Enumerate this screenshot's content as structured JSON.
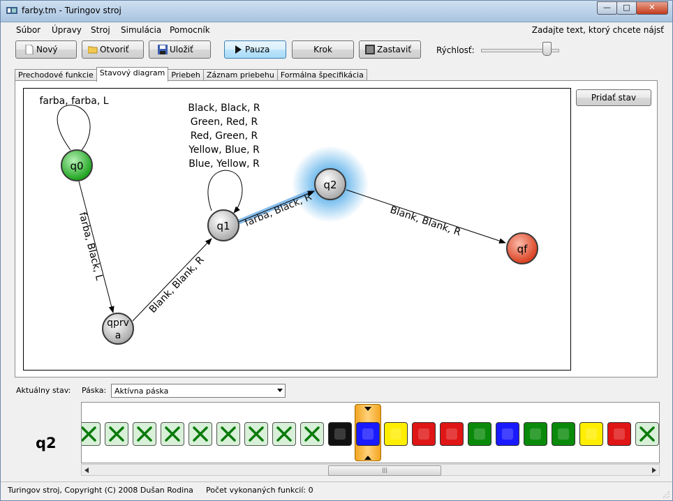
{
  "window": {
    "title": "farby.tm - Turingov stroj",
    "btn_min": "—",
    "btn_max": "□",
    "btn_close": "✕"
  },
  "menu": {
    "file": "Súbor",
    "edit": "Úpravy",
    "machine": "Stroj",
    "simulation": "Simulácia",
    "help": "Pomocník",
    "find_hint": "Zadajte text, ktorý chcete nájsť"
  },
  "toolbar": {
    "new": "Nový",
    "open": "Otvoriť",
    "save": "Uložiť",
    "pause": "Pauza",
    "step": "Krok",
    "stop": "Zastaviť",
    "speed_label": "Rýchlosť:",
    "speed_value": 0.9
  },
  "tabs": [
    "Prechodové funkcie",
    "Stavový diagram",
    "Priebeh",
    "Záznam priebehu",
    "Formálna špecifikácia"
  ],
  "add_state_button": "Pridať stav",
  "diagram": {
    "states": {
      "q0": "q0",
      "q1": "q1",
      "q2": "q2",
      "qf": "qf",
      "qprva_1": "qprv",
      "qprva_2": "a"
    },
    "labels": {
      "q0_loop": "farba, farba, L",
      "q0_to_qprva": "farba, Black, L",
      "qprva_to_q1": "Blank, Blank, R",
      "q1_to_q2": "farba, Black, R",
      "q2_to_qf": "Blank, Blank, R",
      "q1_loop": [
        "Black, Black, R",
        "Green, Red, R",
        "Red, Green, R",
        "Yellow, Blue, R",
        "Blue, Yellow, R"
      ]
    }
  },
  "bottom": {
    "current_state_label": "Aktuálny stav:",
    "tape_label": "Páska:",
    "tape_selected": "Aktívna páska",
    "current_state": "q2"
  },
  "tape": [
    "blank",
    "blank",
    "blank",
    "blank",
    "blank",
    "blank",
    "blank",
    "blank",
    "blank",
    "Black",
    "Blue",
    "Yellow",
    "Red",
    "Red",
    "Green",
    "Blue",
    "Green",
    "Green",
    "Yellow",
    "Red",
    "blank"
  ],
  "tape_head_index": 10,
  "colors": {
    "Black": "#111111",
    "Blue": "#1a1aff",
    "Yellow": "#ffee00",
    "Red": "#e01515",
    "Green": "#0a8a0a",
    "blank_bg": "#d8f0d8",
    "blank_x": "#0a7a0a"
  },
  "status": {
    "copyright": "Turingov stroj, Copyright (C) 2008 Dušan Rodina",
    "functions_executed": "Počet vykonaných funkcií: 0"
  }
}
